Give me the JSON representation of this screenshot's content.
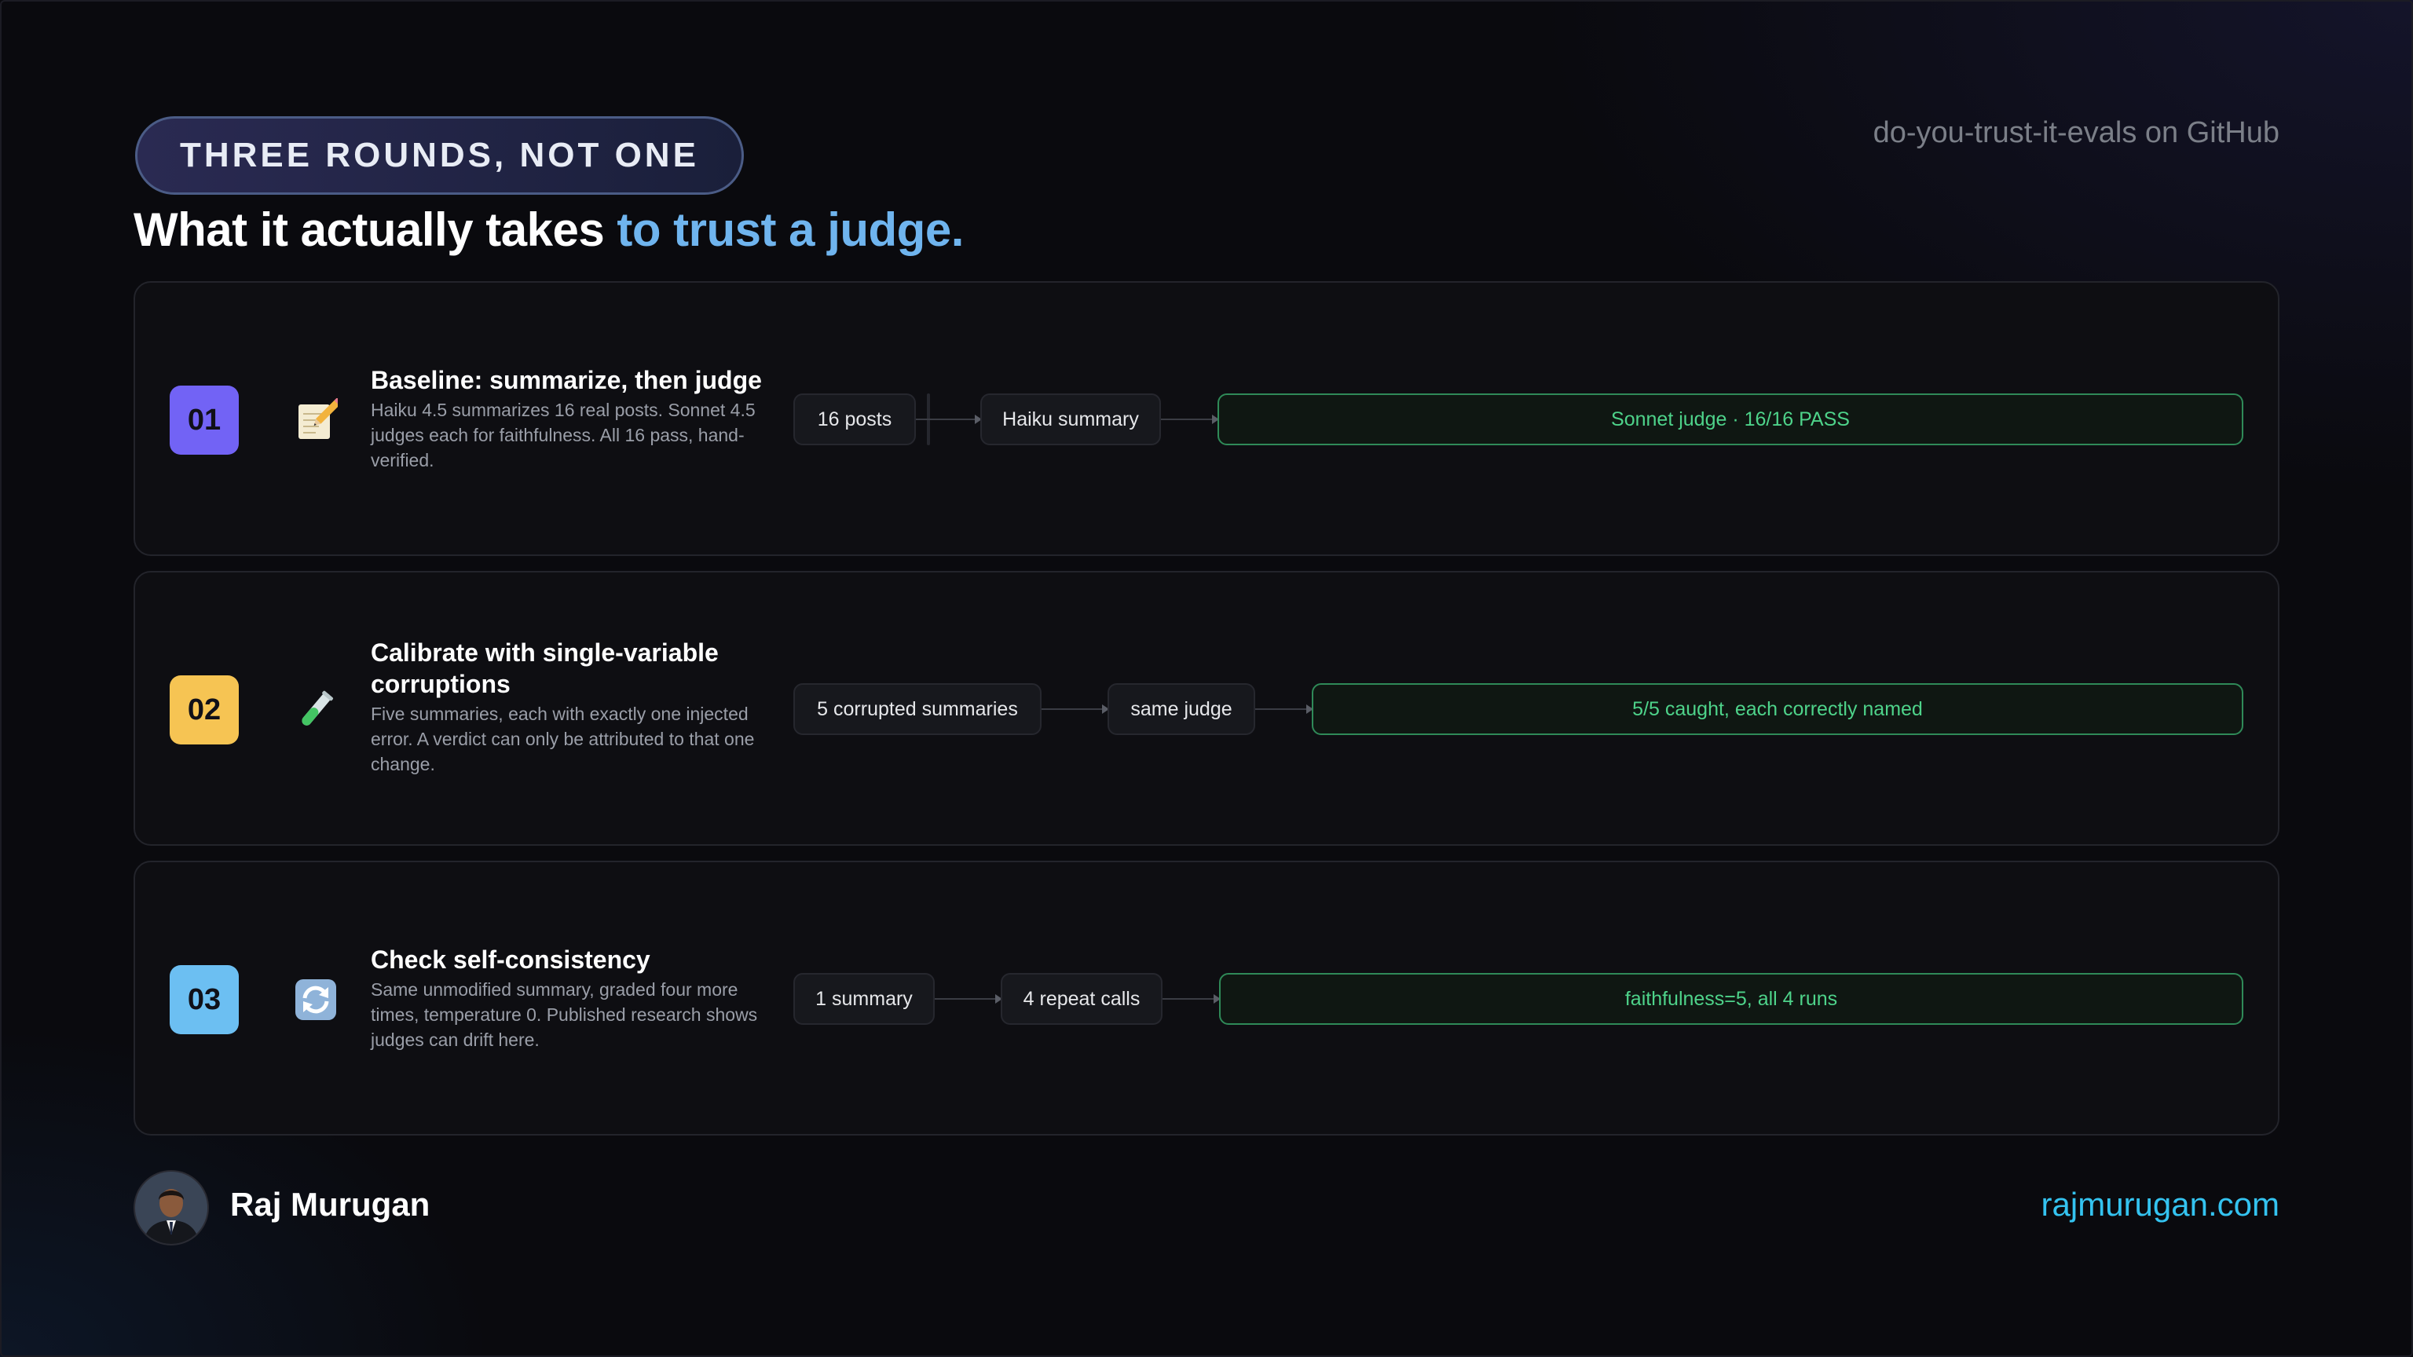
{
  "header": {
    "pill_label": "THREE ROUNDS, NOT ONE",
    "headline_main": "What it actually takes ",
    "headline_accent": "to trust a judge.",
    "repo_label": "do-you-trust-it-evals on GitHub"
  },
  "steps": [
    {
      "number": "01",
      "number_color": "#7263f5",
      "icon": "memo-pencil-icon",
      "title": "Baseline: summarize, then judge",
      "description": "Haiku 4.5 summarizes 16 real posts. Sonnet 4.5 judges each for faithfulness. All 16 pass, hand-verified.",
      "flow": [
        "16 posts",
        "Haiku summary"
      ],
      "result": "Sonnet judge · 16/16 PASS"
    },
    {
      "number": "02",
      "number_color": "#f6c453",
      "icon": "test-tube-icon",
      "title": "Calibrate with single-variable corruptions",
      "description": "Five summaries, each with exactly one injected error. A verdict can only be attributed to that one change.",
      "flow": [
        "5 corrupted summaries",
        "same judge"
      ],
      "result": "5/5 caught, each correctly named"
    },
    {
      "number": "03",
      "number_color": "#6cbff2",
      "icon": "repeat-arrows-icon",
      "title": "Check self-consistency",
      "description": "Same unmodified summary, graded four more times, temperature 0. Published research shows judges can drift here.",
      "flow": [
        "1 summary",
        "4 repeat calls"
      ],
      "result": "faithfulness=5, all 4 runs"
    }
  ],
  "footer": {
    "author_name": "Raj Murugan",
    "website": "rajmurugan.com"
  },
  "colors": {
    "accent_blue": "#6fb4ee",
    "result_green": "#4ed38a",
    "link_cyan": "#34c3f0"
  }
}
